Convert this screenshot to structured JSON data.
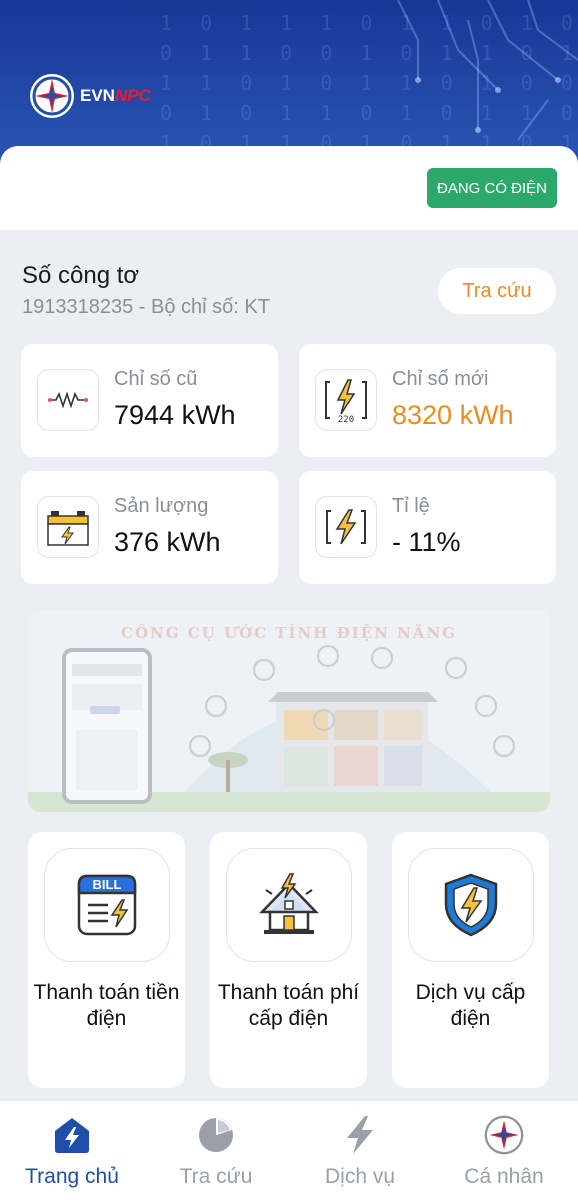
{
  "header": {
    "brand_prefix": "EVN",
    "brand_suffix": "NPC",
    "digits": [
      "1 0 1 1 1 0 1 1 0 1 0 1 0",
      "0 1 1 0 0 1 0 1 1 0 1 1 1",
      "1 1 0 1 0 1 1 0 1 0 0 1 0",
      "0 1 0 1 1 0 1 0 1 1 0 1 1",
      "1 0 1 1 0 1 0 1 1 0 1 0 1"
    ]
  },
  "status": {
    "badge": "ĐANG CÓ ĐIỆN"
  },
  "meter": {
    "title": "Số công tơ",
    "subtitle": "1913318235 - Bộ chỉ số: KT",
    "lookup_label": "Tra cứu"
  },
  "stats": [
    {
      "label": "Chỉ số cũ",
      "value": "7944 kWh",
      "icon": "resistor-icon"
    },
    {
      "label": "Chỉ số mới",
      "value": "8320 kWh",
      "icon": "voltage-220-icon"
    },
    {
      "label": "Sản lượng",
      "value": "376 kWh",
      "icon": "battery-icon"
    },
    {
      "label": "Tỉ lệ",
      "value": "- 11%",
      "icon": "lightning-bracket-icon"
    }
  ],
  "banner": {
    "title": "CÔNG CỤ ƯỚC TÍNH ĐIỆN NĂNG"
  },
  "services": [
    {
      "label": "Thanh toán tiền điện",
      "badge": "BILL",
      "icon": "bill-icon"
    },
    {
      "label": "Thanh toán phí cấp điện",
      "icon": "house-power-icon"
    },
    {
      "label": "Dịch vụ cấp điện",
      "icon": "shield-lightning-icon"
    }
  ],
  "nav": [
    {
      "label": "Trang chủ",
      "icon": "home-icon",
      "active": true
    },
    {
      "label": "Tra cứu",
      "icon": "pie-chart-icon"
    },
    {
      "label": "Dịch vụ",
      "icon": "lightning-icon"
    },
    {
      "label": "Cá nhân",
      "icon": "compass-logo-icon"
    }
  ],
  "colors": {
    "primary": "#1f4fa8",
    "accent": "#f08a1f",
    "status_green": "#2ca86b",
    "header_blue": "#1a3696"
  }
}
